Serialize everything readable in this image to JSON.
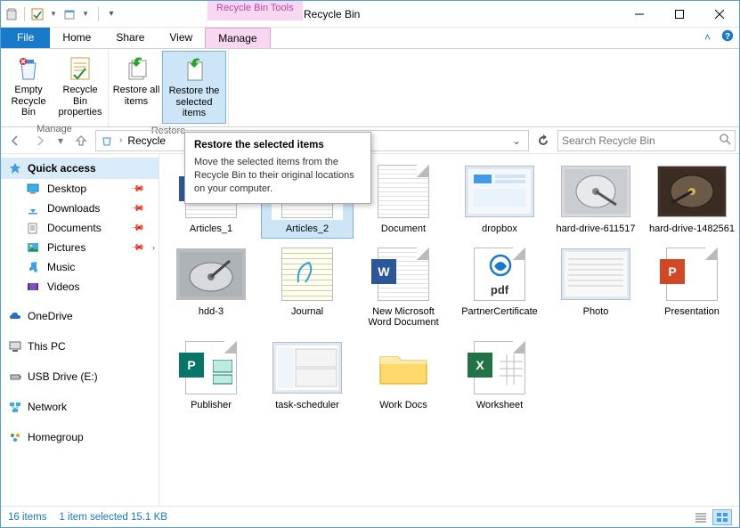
{
  "window": {
    "contextual_tab_label": "Recycle Bin Tools",
    "title": "Recycle Bin"
  },
  "tabs": {
    "file": "File",
    "home": "Home",
    "share": "Share",
    "view": "View",
    "manage": "Manage"
  },
  "ribbon": {
    "group_manage": "Manage",
    "group_restore": "Restore",
    "empty": "Empty Recycle Bin",
    "properties": "Recycle Bin properties",
    "restore_all": "Restore all items",
    "restore_selected": "Restore the selected items"
  },
  "tooltip": {
    "title": "Restore the selected items",
    "body": "Move the selected items from the Recycle Bin to their original locations on your computer."
  },
  "breadcrumb": {
    "location": "Recycle"
  },
  "search": {
    "placeholder": "Search Recycle Bin"
  },
  "nav": {
    "quick_access": "Quick access",
    "desktop": "Desktop",
    "downloads": "Downloads",
    "documents": "Documents",
    "pictures": "Pictures",
    "music": "Music",
    "videos": "Videos",
    "onedrive": "OneDrive",
    "this_pc": "This PC",
    "usb": "USB Drive (E:)",
    "network": "Network",
    "homegroup": "Homegroup"
  },
  "items": [
    {
      "label": "Articles_1",
      "kind": "word"
    },
    {
      "label": "Articles_2",
      "kind": "word",
      "selected": true
    },
    {
      "label": "Document",
      "kind": "text"
    },
    {
      "label": "dropbox",
      "kind": "screenshot"
    },
    {
      "label": "hard-drive-611517",
      "kind": "photo-hdd"
    },
    {
      "label": "hard-drive-1482561",
      "kind": "photo-hdd2"
    },
    {
      "label": "hdd-3",
      "kind": "photo-hdd3"
    },
    {
      "label": "Journal",
      "kind": "journal"
    },
    {
      "label": "New Microsoft Word Document",
      "kind": "word"
    },
    {
      "label": "PartnerCertificate",
      "kind": "pdf"
    },
    {
      "label": "Photo",
      "kind": "screenshot2"
    },
    {
      "label": "Presentation",
      "kind": "ppt"
    },
    {
      "label": "Publisher",
      "kind": "pub"
    },
    {
      "label": "task-scheduler",
      "kind": "screenshot3"
    },
    {
      "label": "Work Docs",
      "kind": "folder"
    },
    {
      "label": "Worksheet",
      "kind": "xls"
    }
  ],
  "status": {
    "count": "16 items",
    "selection": "1 item selected",
    "size": "15.1 KB"
  }
}
